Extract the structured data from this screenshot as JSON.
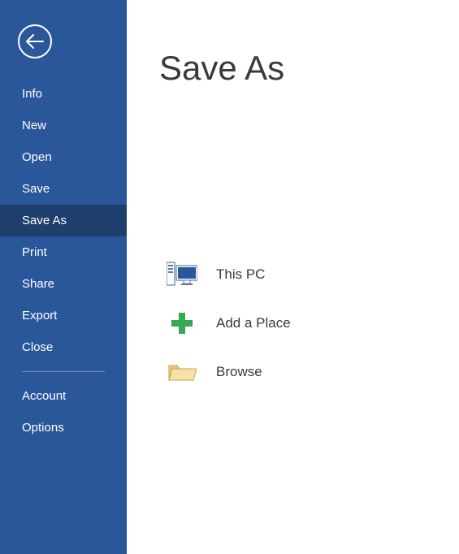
{
  "sidebar": {
    "items": [
      {
        "label": "Info"
      },
      {
        "label": "New"
      },
      {
        "label": "Open"
      },
      {
        "label": "Save"
      },
      {
        "label": "Save As"
      },
      {
        "label": "Print"
      },
      {
        "label": "Share"
      },
      {
        "label": "Export"
      },
      {
        "label": "Close"
      }
    ],
    "footer": [
      {
        "label": "Account"
      },
      {
        "label": "Options"
      }
    ],
    "selected_index": 4
  },
  "main": {
    "title": "Save As",
    "options": [
      {
        "label": "This PC"
      },
      {
        "label": "Add a Place"
      },
      {
        "label": "Browse"
      }
    ]
  },
  "colors": {
    "sidebar": "#2A579A",
    "sidebar_selected": "#1E3E6E",
    "text_dark": "#3a3a3a"
  }
}
